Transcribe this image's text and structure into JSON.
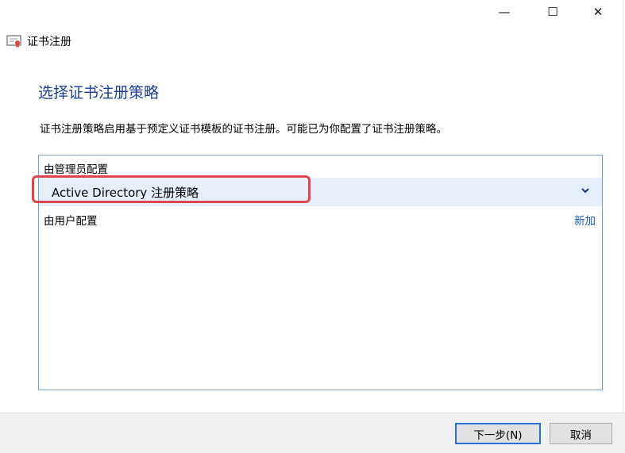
{
  "window": {
    "controls": {
      "minimize": "—",
      "maximize": "☐",
      "close": "✕"
    },
    "title": "证书注册",
    "icon": "certificate-icon"
  },
  "page": {
    "heading": "选择证书注册策略",
    "description": "证书注册策略启用基于预定义证书模板的证书注册。可能已为你配置了证书注册策略。"
  },
  "panel": {
    "admin_group_label": "由管理员配置",
    "policy_item": "Active Directory 注册策略",
    "user_group_label": "由用户配置",
    "add_link": "新加"
  },
  "footer": {
    "next_button": "下一步(N)",
    "cancel_button": "取消"
  },
  "colors": {
    "heading": "#1e3f8f",
    "selection": "#e6eef9",
    "highlight": "#e0454d",
    "link": "#1e5fa8",
    "panel_border": "#7aa0cc"
  }
}
